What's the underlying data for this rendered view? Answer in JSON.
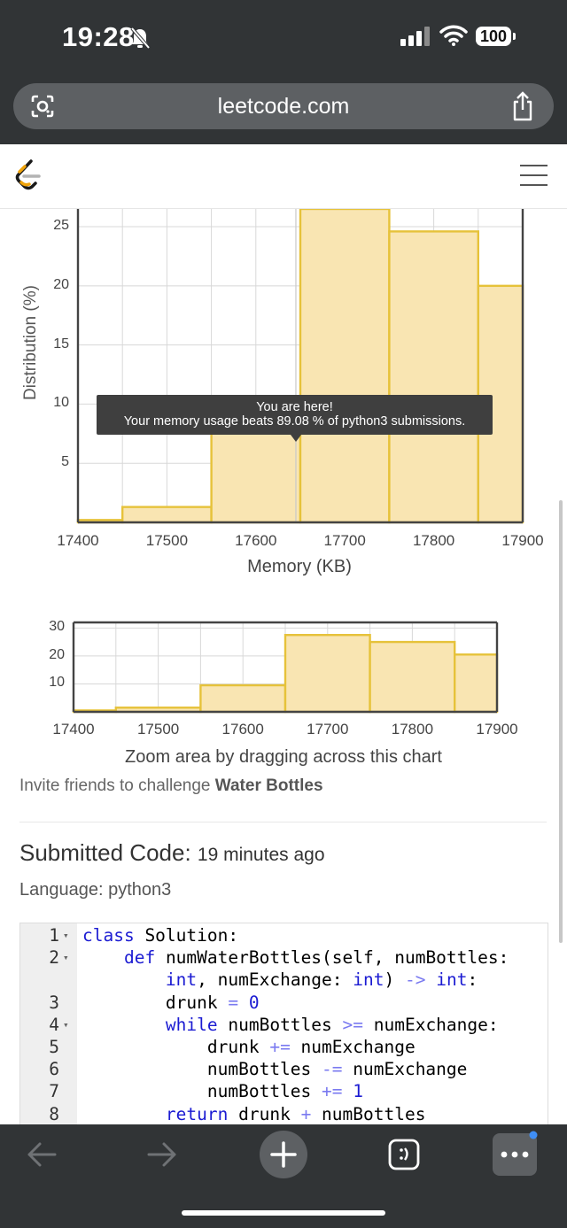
{
  "status": {
    "time": "19:28",
    "battery": "100"
  },
  "browser": {
    "url": "leetcode.com"
  },
  "chart_data": [
    {
      "type": "bar",
      "title": "",
      "xlabel": "Memory (KB)",
      "ylabel": "Distribution (%)",
      "x_ticks": [
        "17400",
        "17500",
        "17600",
        "17700",
        "17800",
        "17900"
      ],
      "y_ticks": [
        "5",
        "10",
        "15",
        "20",
        "25"
      ],
      "bins": [
        {
          "from": 17400,
          "to": 17450,
          "value": 0.2
        },
        {
          "from": 17450,
          "to": 17550,
          "value": 1.3
        },
        {
          "from": 17550,
          "to": 17650,
          "value": 9.5
        },
        {
          "from": 17650,
          "to": 17750,
          "value": 26.5
        },
        {
          "from": 17750,
          "to": 17850,
          "value": 24.6
        },
        {
          "from": 17850,
          "to": 17900,
          "value": 20.0
        }
      ],
      "xlim": [
        17400,
        17900
      ],
      "ylim": [
        0,
        26.5
      ],
      "marker_x": 17645,
      "grid": true,
      "tooltip": {
        "line1": "You are here!",
        "line2": "Your memory usage beats 89.08 % of python3 submissions."
      }
    },
    {
      "type": "bar",
      "title": "",
      "x_ticks": [
        "17400",
        "17500",
        "17600",
        "17700",
        "17800",
        "17900"
      ],
      "y_ticks": [
        "10",
        "20",
        "30"
      ],
      "bins": [
        {
          "from": 17400,
          "to": 17450,
          "value": 0.5
        },
        {
          "from": 17450,
          "to": 17550,
          "value": 1.5
        },
        {
          "from": 17550,
          "to": 17650,
          "value": 9.5
        },
        {
          "from": 17650,
          "to": 17750,
          "value": 27.5
        },
        {
          "from": 17750,
          "to": 17850,
          "value": 25.0
        },
        {
          "from": 17850,
          "to": 17900,
          "value": 20.5
        }
      ],
      "xlim": [
        17400,
        17900
      ],
      "ylim": [
        0,
        32
      ],
      "grid": true
    }
  ],
  "zoom_hint": "Zoom area by dragging across this chart",
  "invite": {
    "prefix": "Invite friends to challenge ",
    "problem": "Water Bottles"
  },
  "submitted": {
    "label": "Submitted Code:",
    "time": "19 minutes ago"
  },
  "language": "Language: python3",
  "code_lines": [
    {
      "num": "1",
      "fold": true,
      "text": "class Solution:"
    },
    {
      "num": "2",
      "fold": true,
      "text": "    def numWaterBottles(self, numBottles:"
    },
    {
      "num": "",
      "fold": false,
      "text": "        int, numExchange: int) -> int:"
    },
    {
      "num": "3",
      "fold": false,
      "text": "        drunk = 0"
    },
    {
      "num": "4",
      "fold": true,
      "text": "        while numBottles >= numExchange:"
    },
    {
      "num": "5",
      "fold": false,
      "text": "            drunk += numExchange"
    },
    {
      "num": "6",
      "fold": false,
      "text": "            numBottles -= numExchange"
    },
    {
      "num": "7",
      "fold": false,
      "text": "            numBottles += 1"
    },
    {
      "num": "8",
      "fold": false,
      "text": "        return drunk + numBottles"
    }
  ],
  "colors": {
    "bar_fill": "#f9e5b2",
    "bar_stroke": "#e6c23a",
    "chrome": "#313436"
  }
}
